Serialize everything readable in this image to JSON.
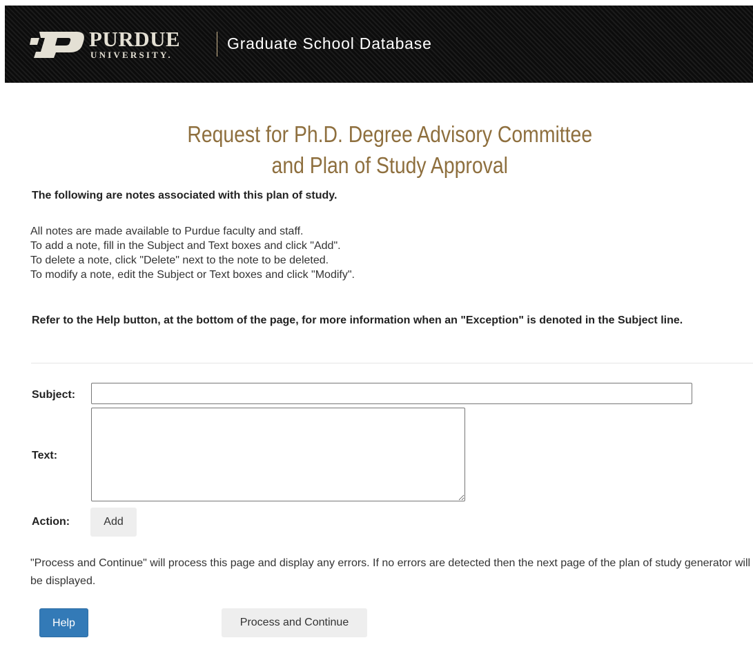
{
  "header": {
    "logo_word": "PURDUE",
    "logo_sub": "UNIVERSITY.",
    "app_title": "Graduate School Database",
    "logo_icon": "purdue-p-motion-mark",
    "brand_gold": "#cfb991"
  },
  "page": {
    "title_line1": "Request for Ph.D. Degree Advisory Committee",
    "title_line2": "and Plan of Study Approval",
    "title_color": "#8e6f3e",
    "intro_heading": "The following are notes associated with this plan of study.",
    "notes": [
      "All notes are made available to Purdue faculty and staff.",
      "To add a note, fill in the Subject and Text boxes and click \"Add\".",
      "To delete a note, click \"Delete\" next to the note to be deleted.",
      "To modify a note, edit the Subject or Text boxes and click \"Modify\"."
    ],
    "exception_note": "Refer to the Help button, at the bottom of the page, for more information when an \"Exception\" is denoted in the Subject line."
  },
  "form": {
    "subject_label": "Subject:",
    "subject_value": "",
    "text_label": "Text:",
    "text_value": "",
    "action_label": "Action:",
    "add_label": "Add"
  },
  "footer": {
    "process_note": "\"Process and Continue\" will process this page and display any errors. If no errors are detected then the next page of the plan of study generator will be displayed.",
    "help_label": "Help",
    "continue_label": "Process and Continue",
    "help_color": "#337ab7"
  }
}
